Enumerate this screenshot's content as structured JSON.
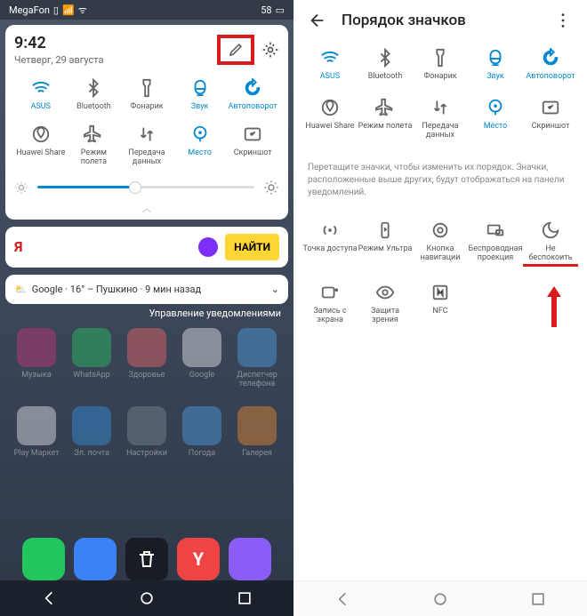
{
  "left": {
    "status": {
      "carrier": "MegaFon",
      "battery_text": "58"
    },
    "notif": {
      "time": "9:42",
      "date": "Четверг, 29 августа",
      "qs": [
        {
          "name": "wifi",
          "label": "ASUS",
          "active": true
        },
        {
          "name": "bluetooth",
          "label": "Bluetooth",
          "active": false
        },
        {
          "name": "flashlight",
          "label": "Фонарик",
          "active": false
        },
        {
          "name": "sound",
          "label": "Звук",
          "active": true
        },
        {
          "name": "autorotate",
          "label": "Автоповорот",
          "active": true
        },
        {
          "name": "huawei-share",
          "label": "Huawei Share",
          "active": false
        },
        {
          "name": "airplane",
          "label": "Режим полета",
          "active": false
        },
        {
          "name": "data",
          "label": "Передача данных",
          "active": false
        },
        {
          "name": "location",
          "label": "Место",
          "active": true
        },
        {
          "name": "screenshot",
          "label": "Скриншот",
          "active": false
        }
      ]
    },
    "search": {
      "logo": "Я",
      "find": "НАЙТИ"
    },
    "weather": "Google · 16° – Пушкино · 9 мин назад",
    "notif_mgmt": "Управление уведомлениями",
    "apps_row1": [
      {
        "label": "Музыка",
        "color": "#d63384"
      },
      {
        "label": "WhatsApp",
        "color": "#25d366"
      },
      {
        "label": "Здоровье",
        "color": "#ff6b6b"
      },
      {
        "label": "Google",
        "color": "#fff"
      },
      {
        "label": "Диспетчер телефона",
        "color": "#4dabf7"
      }
    ],
    "apps_row2": [
      {
        "label": "Play Маркет",
        "color": "#fff"
      },
      {
        "label": "Эл. почта",
        "color": "#339af0"
      },
      {
        "label": "Настройки",
        "color": "#868e96"
      },
      {
        "label": "Погода",
        "color": "#4dabf7"
      },
      {
        "label": "Галерея",
        "color": "#ff922b"
      }
    ]
  },
  "right": {
    "title": "Порядок значков",
    "qs": [
      {
        "name": "wifi",
        "label": "ASUS",
        "active": true
      },
      {
        "name": "bluetooth",
        "label": "Bluetooth",
        "active": false
      },
      {
        "name": "flashlight",
        "label": "Фонарик",
        "active": false
      },
      {
        "name": "sound",
        "label": "Звук",
        "active": true
      },
      {
        "name": "autorotate",
        "label": "Автоповорот",
        "active": true
      },
      {
        "name": "huawei-share",
        "label": "Huawei Share",
        "active": false
      },
      {
        "name": "airplane",
        "label": "Режим полета",
        "active": false
      },
      {
        "name": "data",
        "label": "Передача данных",
        "active": false
      },
      {
        "name": "location",
        "label": "Место",
        "active": true
      },
      {
        "name": "screenshot",
        "label": "Скриншот",
        "active": false
      }
    ],
    "hint": "Перетащите значки, чтобы изменить их порядок. Значки, расположенные выше других, будут отображаться на панели уведомлений.",
    "extra": [
      {
        "name": "hotspot",
        "label": "Точка доступа"
      },
      {
        "name": "ultra",
        "label": "Режим Ультра"
      },
      {
        "name": "nav-button",
        "label": "Кнопка навигации"
      },
      {
        "name": "wireless-proj",
        "label": "Беспроводная проекция"
      },
      {
        "name": "dnd",
        "label": "Не беспокоить",
        "underline": true
      },
      {
        "name": "screen-rec",
        "label": "Запись с экрана"
      },
      {
        "name": "eye-protect",
        "label": "Защита зрения"
      },
      {
        "name": "nfc",
        "label": "NFC"
      }
    ]
  }
}
